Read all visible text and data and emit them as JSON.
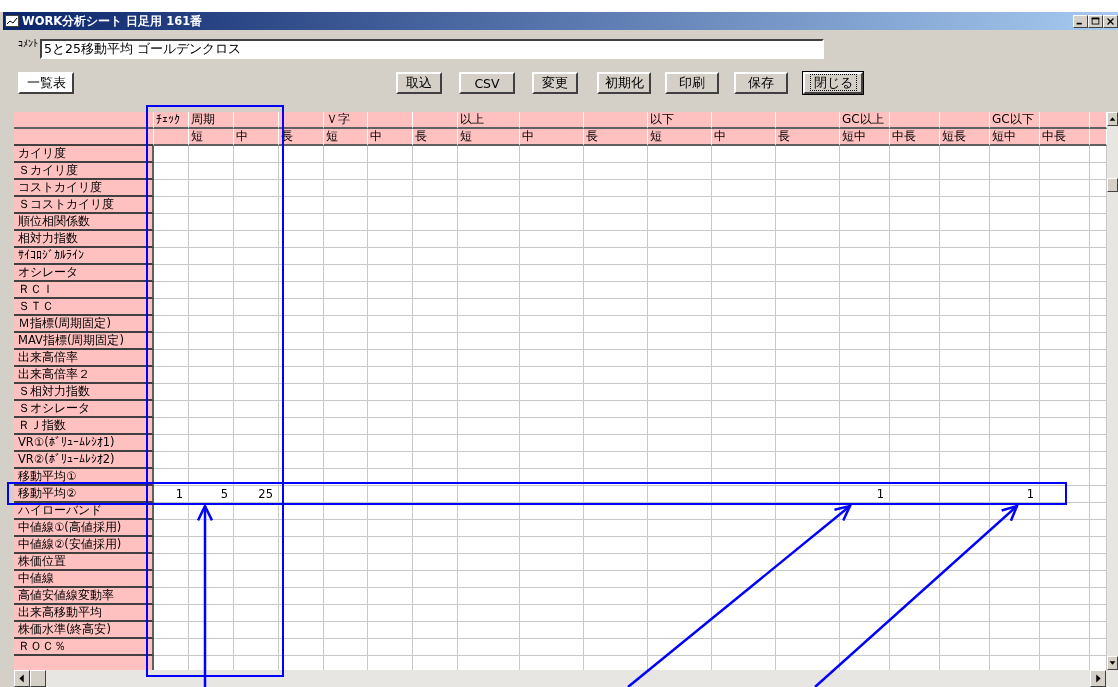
{
  "window": {
    "title": "WORK分析シート 日足用 161番"
  },
  "comment": {
    "label": "ｺﾒﾝﾄ",
    "value": "5と25移動平均 ゴールデンクロス"
  },
  "buttons": [
    {
      "label": "一覧表",
      "kind": "list",
      "focused": false
    },
    {
      "label": "取込",
      "kind": "command",
      "focused": false
    },
    {
      "label": "CSV",
      "kind": "command",
      "focused": false
    },
    {
      "label": "変更",
      "kind": "command",
      "focused": false
    },
    {
      "label": "初期化",
      "kind": "command",
      "focused": false
    },
    {
      "label": "印刷",
      "kind": "command",
      "focused": false
    },
    {
      "label": "保存",
      "kind": "command",
      "focused": false
    },
    {
      "label": "閉じる",
      "kind": "command",
      "focused": true
    }
  ],
  "table": {
    "columns": [
      {
        "group": "ﾁｪｯｸ"
      },
      {
        "group": "周期",
        "label": "短"
      },
      {
        "label": "中"
      },
      {
        "label": "長"
      },
      {
        "group": "Ｖ字",
        "label": "短"
      },
      {
        "label": "中"
      },
      {
        "label": "長"
      },
      {
        "group": "以上",
        "label": "短"
      },
      {
        "label": "中"
      },
      {
        "label": "長"
      },
      {
        "group": "以下",
        "label": "短"
      },
      {
        "label": "中"
      },
      {
        "label": "長"
      },
      {
        "group": "GC以上",
        "label": "短中"
      },
      {
        "label": "中長"
      },
      {
        "label": "短長"
      },
      {
        "group": "GC以下",
        "label": "短中"
      },
      {
        "label": "中長"
      }
    ],
    "rows": [
      {
        "label": "カイリ度"
      },
      {
        "label": "Ｓカイリ度"
      },
      {
        "label": "コストカイリ度"
      },
      {
        "label": "Ｓコストカイリ度"
      },
      {
        "label": "順位相関係数"
      },
      {
        "label": "相対力指数"
      },
      {
        "label": "ｻｲｺﾛｼﾞｶﾙﾗｲﾝ"
      },
      {
        "label": "オシレータ"
      },
      {
        "label": "ＲＣＩ"
      },
      {
        "label": "ＳＴＣ"
      },
      {
        "label": "Ｍ指標(周期固定)"
      },
      {
        "label": "MAV指標(周期固定)"
      },
      {
        "label": "出来高倍率"
      },
      {
        "label": "出来高倍率２"
      },
      {
        "label": "Ｓ相対力指数"
      },
      {
        "label": "Ｓオシレータ"
      },
      {
        "label": "ＲＪ指数"
      },
      {
        "label": "VR①(ﾎﾞﾘｭｰﾑﾚｼｵ1)"
      },
      {
        "label": "VR②(ﾎﾞﾘｭｰﾑﾚｼｵ2)"
      },
      {
        "label": "移動平均①"
      },
      {
        "label": "移動平均②",
        "cells": [
          "1",
          "5",
          "25",
          null,
          null,
          null,
          null,
          null,
          null,
          null,
          null,
          null,
          null,
          "1",
          null,
          null,
          "1",
          null
        ]
      },
      {
        "label": "ハイローバンド"
      },
      {
        "label": "中値線①(高値採用)"
      },
      {
        "label": "中値線②(安値採用)"
      },
      {
        "label": "株価位置"
      },
      {
        "label": "中値線"
      },
      {
        "label": "高値安値線変動率"
      },
      {
        "label": "出来高移動平均"
      },
      {
        "label": "株価水準(終高安)"
      },
      {
        "label": "ＲＯＣ％"
      }
    ]
  }
}
